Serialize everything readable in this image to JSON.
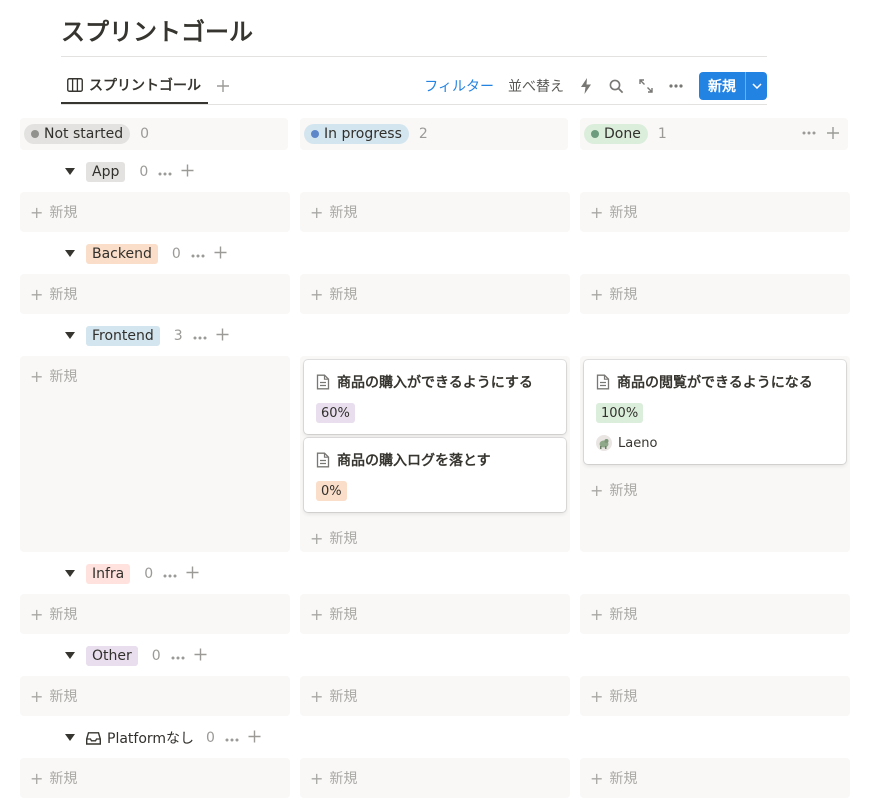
{
  "page": {
    "title": "スプリントゴール"
  },
  "toolbar": {
    "view_tab_label": "スプリントゴール",
    "filter_label": "フィルター",
    "sort_label": "並べ替え",
    "new_button_label": "新規"
  },
  "columns": [
    {
      "label": "Not started",
      "count": "0",
      "pill_bg": "#e3e2e0",
      "dot": "#91918e"
    },
    {
      "label": "In progress",
      "count": "2",
      "pill_bg": "#d3e5ef",
      "dot": "#5e87c9"
    },
    {
      "label": "Done",
      "count": "1",
      "pill_bg": "#dbeddb",
      "dot": "#6c9b7d"
    }
  ],
  "new_item_label": "新規",
  "groups": [
    {
      "label": "App",
      "count": "0",
      "color": "#e3e2e0"
    },
    {
      "label": "Backend",
      "count": "0",
      "color": "#fadec9"
    },
    {
      "label": "Frontend",
      "count": "3",
      "color": "#d3e5ef"
    },
    {
      "label": "Infra",
      "count": "0",
      "color": "#ffe2dd"
    },
    {
      "label": "Other",
      "count": "0",
      "color": "#e8deee"
    },
    {
      "label": "Platformなし",
      "count": "0",
      "color": ""
    }
  ],
  "cards": [
    {
      "title": "商品の購入ができるようにする",
      "progress": "60%",
      "badge_color": "#e8deee",
      "status": "In progress",
      "group": "Frontend"
    },
    {
      "title": "商品の購入ログを落とす",
      "progress": "0%",
      "badge_color": "#fadec9",
      "status": "In progress",
      "group": "Frontend"
    },
    {
      "title": "商品の閲覧ができるようになる",
      "progress": "100%",
      "badge_color": "#dbeddb",
      "assignee": "Laeno",
      "status": "Done",
      "group": "Frontend"
    }
  ],
  "icons": {
    "view_tab": "board-view-icon",
    "add_view": "plus-icon",
    "automation": "lightning-icon",
    "search": "search-icon",
    "expand": "expand-icon",
    "more": "more-dots-icon",
    "dropdown": "chevron-down-icon",
    "toggle": "triangle-down-icon",
    "page": "page-icon",
    "no_group": "inbox-icon"
  },
  "colors": {
    "accent": "#2383e2"
  }
}
